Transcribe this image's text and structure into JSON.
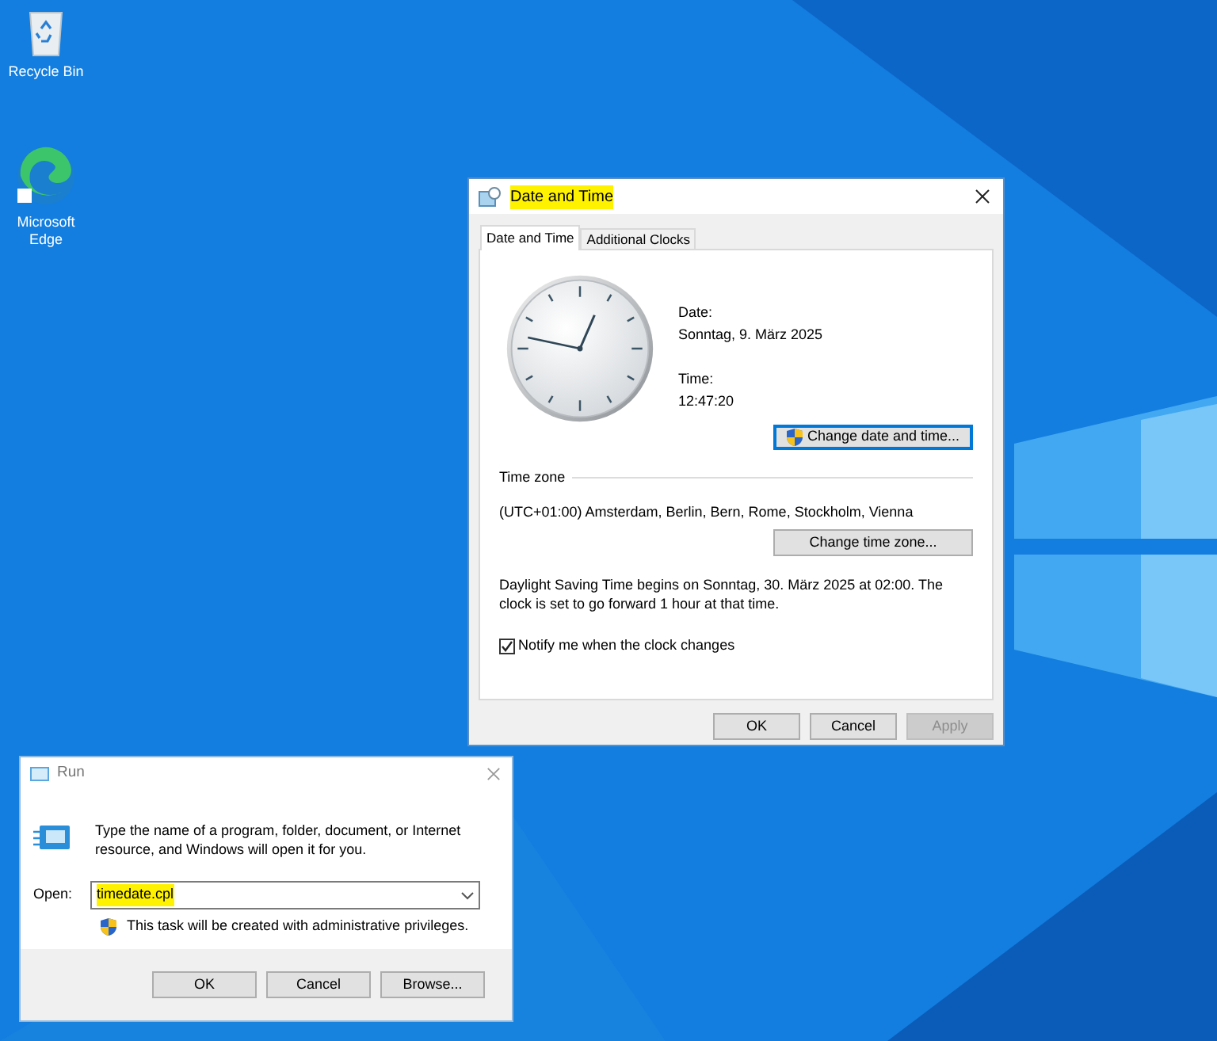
{
  "desktop_icons": [
    {
      "kind": "recycle-bin",
      "label": "Recycle Bin"
    },
    {
      "kind": "browser",
      "label": "Microsoft Edge"
    }
  ],
  "date_time_window": {
    "title": "Date and Time",
    "title_highlighted": true,
    "tabs": [
      {
        "label": "Date and Time",
        "selected": true
      },
      {
        "label": "Additional Clocks",
        "selected": false
      }
    ],
    "date_label": "Date:",
    "date_value": "Sonntag, 9. März 2025",
    "time_label": "Time:",
    "time_value": "12:47:20",
    "change_date_button": {
      "label": "Change date and time...",
      "focused": true
    },
    "time_zone_heading": "Time zone",
    "time_zone_value": "(UTC+01:00) Amsterdam, Berlin, Bern, Rome, Stockholm, Vienna",
    "change_time_zone_button": {
      "label": "Change time zone...",
      "focused": false
    },
    "dst_note": "Daylight Saving Time begins on Sonntag, 30. März 2025 at 02:00. The clock is set to go forward 1 hour at that time.",
    "notify_checkbox": {
      "label": "Notify me when the clock changes",
      "checked": true
    },
    "buttons": [
      {
        "label": "OK",
        "disabled": false
      },
      {
        "label": "Cancel",
        "disabled": false
      },
      {
        "label": "Apply",
        "disabled": true
      }
    ]
  },
  "run_window": {
    "title": "Run",
    "description": "Type the name of a program, folder, document, or Internet resource, and Windows will open it for you.",
    "open_label": "Open:",
    "open_value": "timedate.cpl",
    "value_highlighted": true,
    "admin_note": "This task will be created with administrative privileges.",
    "buttons": [
      {
        "label": "OK",
        "disabled": false
      },
      {
        "label": "Cancel",
        "disabled": false
      },
      {
        "label": "Browse...",
        "disabled": false
      }
    ]
  }
}
